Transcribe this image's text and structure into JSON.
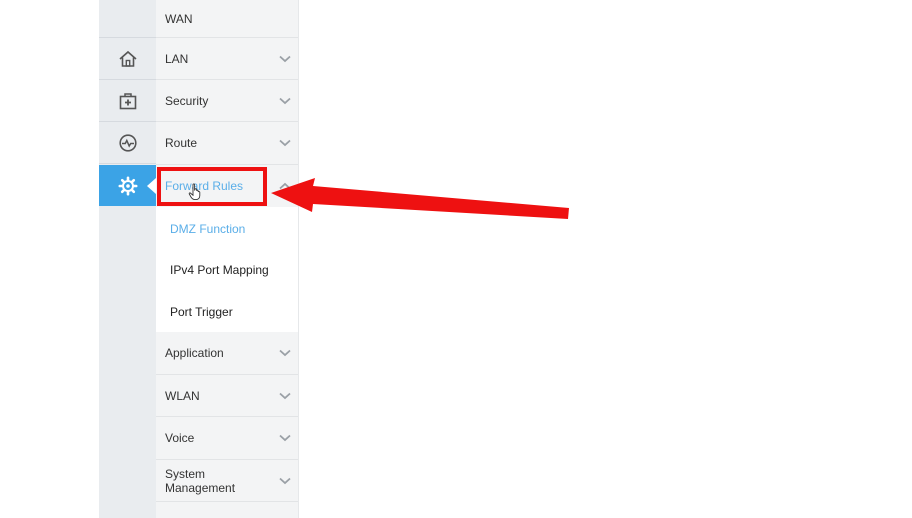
{
  "rail": {
    "icons": [
      "home-icon",
      "maintenance-kit-icon",
      "monitor-icon",
      "gear-icon"
    ],
    "active": "gear-icon",
    "active_color": "#3ba3e6"
  },
  "menu": {
    "items": [
      {
        "label": "WAN"
      },
      {
        "label": "LAN"
      },
      {
        "label": "Security"
      },
      {
        "label": "Route"
      },
      {
        "label": "Forward Rules"
      },
      {
        "label": "Application"
      },
      {
        "label": "WLAN"
      },
      {
        "label": "Voice"
      },
      {
        "label": "System Management"
      }
    ],
    "forward_rules_sub": [
      {
        "label": "DMZ Function"
      },
      {
        "label": "IPv4 Port Mapping"
      },
      {
        "label": "Port Trigger"
      }
    ]
  },
  "annotation": {
    "color": "#ee1111",
    "target": "Forward Rules"
  }
}
